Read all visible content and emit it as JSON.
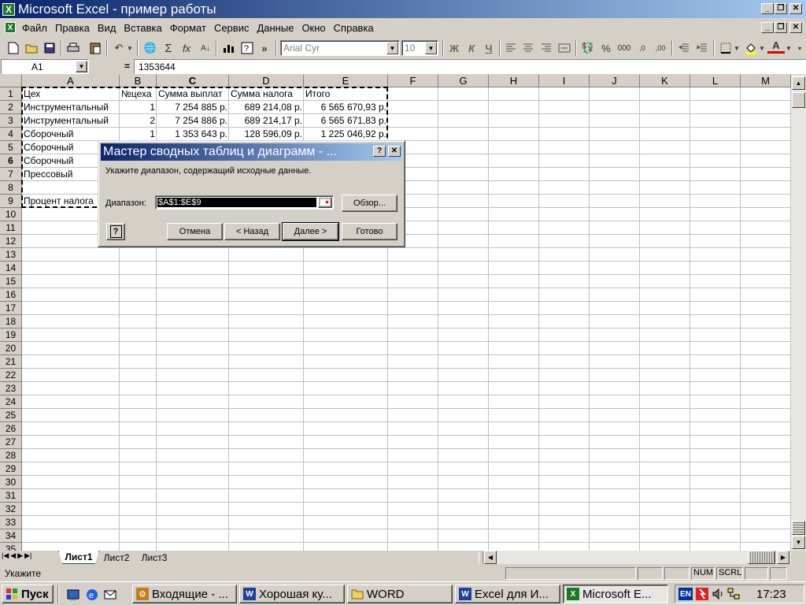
{
  "window": {
    "title": "Microsoft Excel - пример работы",
    "app_icon": "excel-icon"
  },
  "menu": [
    "Файл",
    "Правка",
    "Вид",
    "Вставка",
    "Формат",
    "Сервис",
    "Данные",
    "Окно",
    "Справка"
  ],
  "toolbar": {
    "font_name": "Arial Cyr",
    "font_size": "10",
    "bold_label": "Ж",
    "italic_label": "К",
    "underline_label": "Ч",
    "sum_label": "Σ",
    "fx_label": "fx",
    "percent_label": "%",
    "thousands_label": "000",
    "more_label": "»",
    "font_color_label": "A"
  },
  "formula_bar": {
    "name_box": "A1",
    "equals": "=",
    "value": "1353644"
  },
  "columns": [
    "A",
    "B",
    "C",
    "D",
    "E",
    "F",
    "G",
    "H",
    "I",
    "J",
    "K",
    "L",
    "M"
  ],
  "rows": [
    "1",
    "2",
    "3",
    "4",
    "5",
    "6",
    "7",
    "8",
    "9",
    "10",
    "11",
    "12",
    "13",
    "14",
    "15",
    "16",
    "17",
    "18",
    "19",
    "20",
    "21",
    "22",
    "23",
    "24",
    "25",
    "26",
    "27",
    "28",
    "29",
    "30",
    "31",
    "32",
    "33",
    "34",
    "35"
  ],
  "cells": {
    "A1": "Цех",
    "B1": "№цеха",
    "C1": "Сумма выплат",
    "D1": "Сумма налога",
    "E1": "Итого",
    "A2": "Инструментальный",
    "B2": "1",
    "C2": "7 254 885 р.",
    "D2": "689 214,08 р.",
    "E2": "6 565 670,93 р.",
    "A3": "Инструментальный",
    "B3": "2",
    "C3": "7 254 886 р.",
    "D3": "689 214,17 р.",
    "E3": "6 565 671,83 р.",
    "A4": "Сборочный",
    "B4": "1",
    "C4": "1 353 643 р.",
    "D4": "128 596,09 р.",
    "E4": "1 225 046,92 р.",
    "A5": "Сборочный",
    "A6": "Сборочный",
    "A7": "Прессовый",
    "A9": "Процент налога"
  },
  "sheet_tabs": [
    "Лист1",
    "Лист2",
    "Лист3"
  ],
  "status": {
    "text": "Укажите",
    "num": "NUM",
    "scrl": "SCRL"
  },
  "dialog": {
    "title": "Мастер сводных таблиц и диаграмм - ...",
    "help_glyph": "?",
    "close_glyph": "✕",
    "prompt": "Укажите диапазон, содержащий исходные данные.",
    "range_label": "Диапазон:",
    "range_value": "$A$1:$E$9",
    "browse": "Обзор...",
    "cancel": "Отмена",
    "back": "< Назад",
    "next": "Далее >",
    "finish": "Готово",
    "wizard_help_glyph": "?"
  },
  "taskbar": {
    "start": "Пуск",
    "tasks": [
      {
        "label": "Входящие - ...",
        "icon": "outlook-icon"
      },
      {
        "label": "Хорошая ку...",
        "icon": "word-doc-icon"
      },
      {
        "label": "WORD",
        "icon": "folder-icon"
      },
      {
        "label": "Excel для И...",
        "icon": "word-doc-icon"
      },
      {
        "label": "Microsoft E...",
        "icon": "excel-icon",
        "active": true
      }
    ],
    "lang": "EN",
    "clock": "17:23"
  },
  "colors": {
    "title_active": "#0a246a",
    "title_gradient_end": "#a6caf0",
    "face": "#d4d0c8",
    "grid_line": "#c0c0c0",
    "excel_green": "#1a7a2a"
  }
}
